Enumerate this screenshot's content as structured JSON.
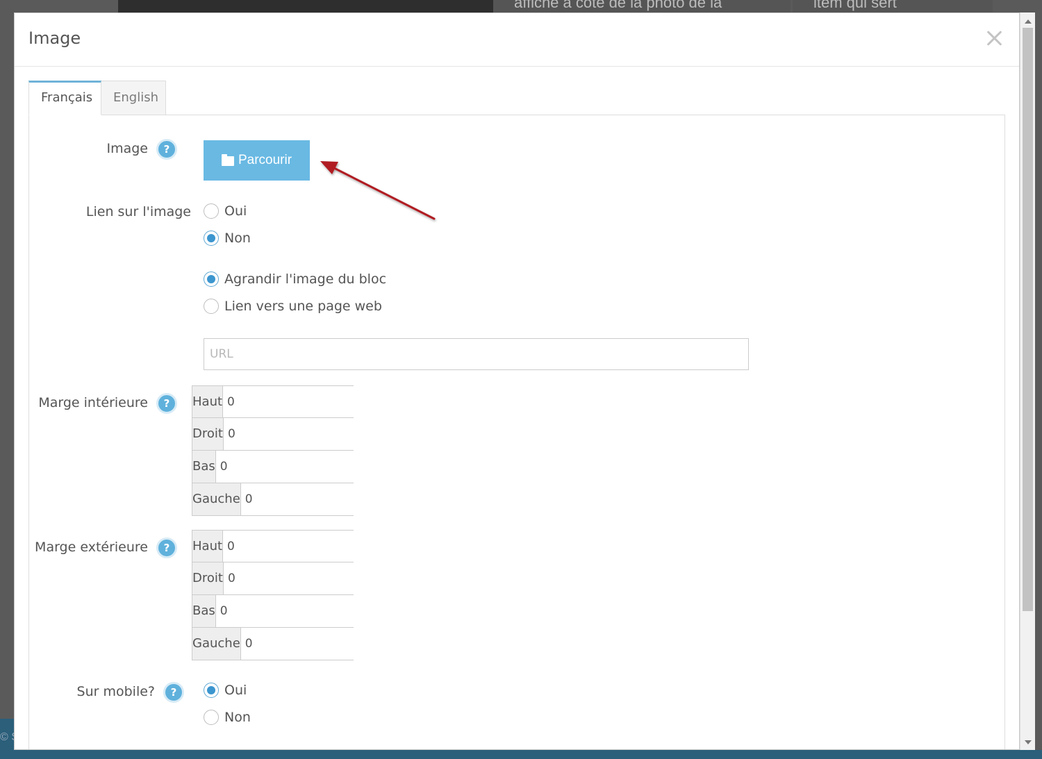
{
  "background": {
    "caption_left": "affiche à côté de la photo de la",
    "caption_right": "item qui sert",
    "footer_text": "© S"
  },
  "modal": {
    "title": "Image",
    "close_icon": "close-icon"
  },
  "tabs": [
    {
      "label": "Français",
      "active": true
    },
    {
      "label": "English",
      "active": false
    }
  ],
  "form": {
    "image": {
      "label": "Image",
      "button_label": "Parcourir",
      "button_icon": "folder-icon"
    },
    "link": {
      "label": "Lien sur l'image",
      "options": [
        {
          "label": "Oui",
          "checked": false
        },
        {
          "label": "Non",
          "checked": true
        }
      ],
      "link_type_options": [
        {
          "label": "Agrandir l'image du bloc",
          "checked": true
        },
        {
          "label": "Lien vers une page web",
          "checked": false
        }
      ],
      "url_placeholder": "URL",
      "url_value": ""
    },
    "inner_margin": {
      "label": "Marge intérieure",
      "rows": [
        {
          "side": "Haut",
          "value": "0"
        },
        {
          "side": "Droit",
          "value": "0"
        },
        {
          "side": "Bas",
          "value": "0"
        },
        {
          "side": "Gauche",
          "value": "0"
        }
      ]
    },
    "outer_margin": {
      "label": "Marge extérieure",
      "rows": [
        {
          "side": "Haut",
          "value": "0"
        },
        {
          "side": "Droit",
          "value": "0"
        },
        {
          "side": "Bas",
          "value": "0"
        },
        {
          "side": "Gauche",
          "value": "0"
        }
      ]
    },
    "mobile": {
      "label": "Sur mobile?",
      "options": [
        {
          "label": "Oui",
          "checked": true
        },
        {
          "label": "Non",
          "checked": false
        }
      ]
    },
    "help_icon_text": "?"
  },
  "colors": {
    "accent": "#69b9e3",
    "help_icon": "#5fb1dc",
    "radio_checked": "#3c96cf",
    "annotation_arrow": "#b01f24"
  }
}
